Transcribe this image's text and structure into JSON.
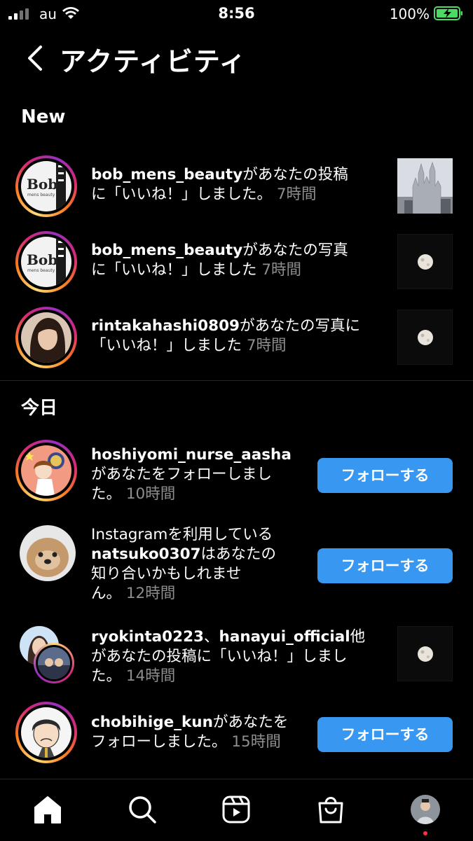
{
  "status_bar": {
    "carrier": "au",
    "time": "8:56",
    "battery": "100%"
  },
  "header": {
    "title": "アクティビティ"
  },
  "sections": {
    "new": "New",
    "today": "今日"
  },
  "new_items": [
    {
      "username": "bob_mens_beauty",
      "line1": "があなたの投稿",
      "line2": "に「いいね！」しました。",
      "time": "7時間",
      "thumb": "castle"
    },
    {
      "username": "bob_mens_beauty",
      "line1": "があなたの写真",
      "line2": "に「いいね！」しました",
      "time": "7時間",
      "thumb": "moon"
    },
    {
      "username": "rintakahashi0809",
      "line1": "があなたの写真に",
      "line2": "「いいね！」しました",
      "time": "7時間",
      "thumb": "moon"
    }
  ],
  "today_items": [
    {
      "username": "hoshiyomi_nurse_aasha",
      "line1": "があなたをフォローしまし",
      "line2": "た。",
      "time": "10時間",
      "button": "フォローする"
    },
    {
      "prefix": "Instagramを利用している",
      "username": "natsuko0307",
      "line1": "はあなたの",
      "line2": "知り合いかもしれませ",
      "line3": "ん。",
      "time": "12時間",
      "button": "フォローする"
    },
    {
      "username": "ryokinta0223",
      "separator": "、",
      "username2": "hanayui_official",
      "suffix": "他",
      "line1": "があなたの投稿に「いいね！」しまし",
      "line2": "た。",
      "time": "14時間",
      "thumb": "moon"
    },
    {
      "username": "chobihige_kun",
      "line1": "があなたを",
      "line2": "フォローしました。",
      "time": "15時間",
      "button": "フォローする"
    }
  ],
  "avatar_labels": {
    "bob": "Bob",
    "bob_sub": "mens beauty"
  },
  "icons": [
    "signal-icon",
    "wifi-icon",
    "battery-charging-icon",
    "back-chevron-icon",
    "home-icon",
    "search-icon",
    "reels-icon",
    "shop-icon",
    "profile-avatar"
  ],
  "colors": {
    "background": "#000000",
    "follow_button": "#3897f0",
    "timestamp": "#8e8e8e",
    "battery_green": "#4cd964"
  }
}
